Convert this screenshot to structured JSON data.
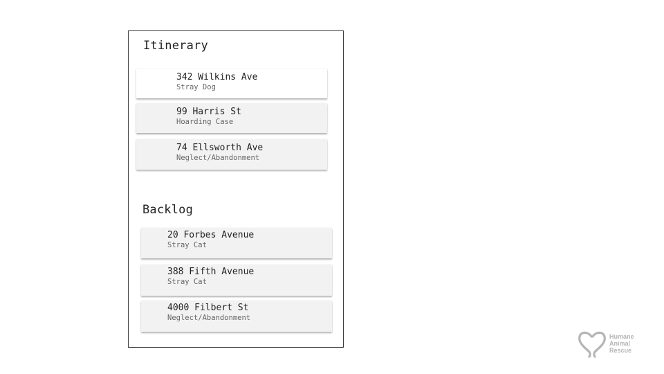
{
  "itinerary": {
    "title": "Itinerary",
    "items": [
      {
        "address": "342 Wilkins Ave",
        "type": "Stray Dog"
      },
      {
        "address": "99 Harris St",
        "type": "Hoarding Case"
      },
      {
        "address": "74 Ellsworth Ave",
        "type": "Neglect/Abandonment"
      }
    ]
  },
  "backlog": {
    "title": "Backlog",
    "items": [
      {
        "address": "20 Forbes Avenue",
        "type": "Stray Cat"
      },
      {
        "address": "388 Fifth Avenue",
        "type": "Stray Cat"
      },
      {
        "address": "4000 Filbert St",
        "type": "Neglect/Abandonment"
      }
    ]
  },
  "logo": {
    "icon": "heart-outline-icon",
    "line1": "Humane",
    "line2": "Animal",
    "line3": "Rescue",
    "color": "#b5b5b5"
  },
  "colors": {
    "card_bg": "#f2f2f2",
    "frame_border": "#3a3a3a"
  }
}
